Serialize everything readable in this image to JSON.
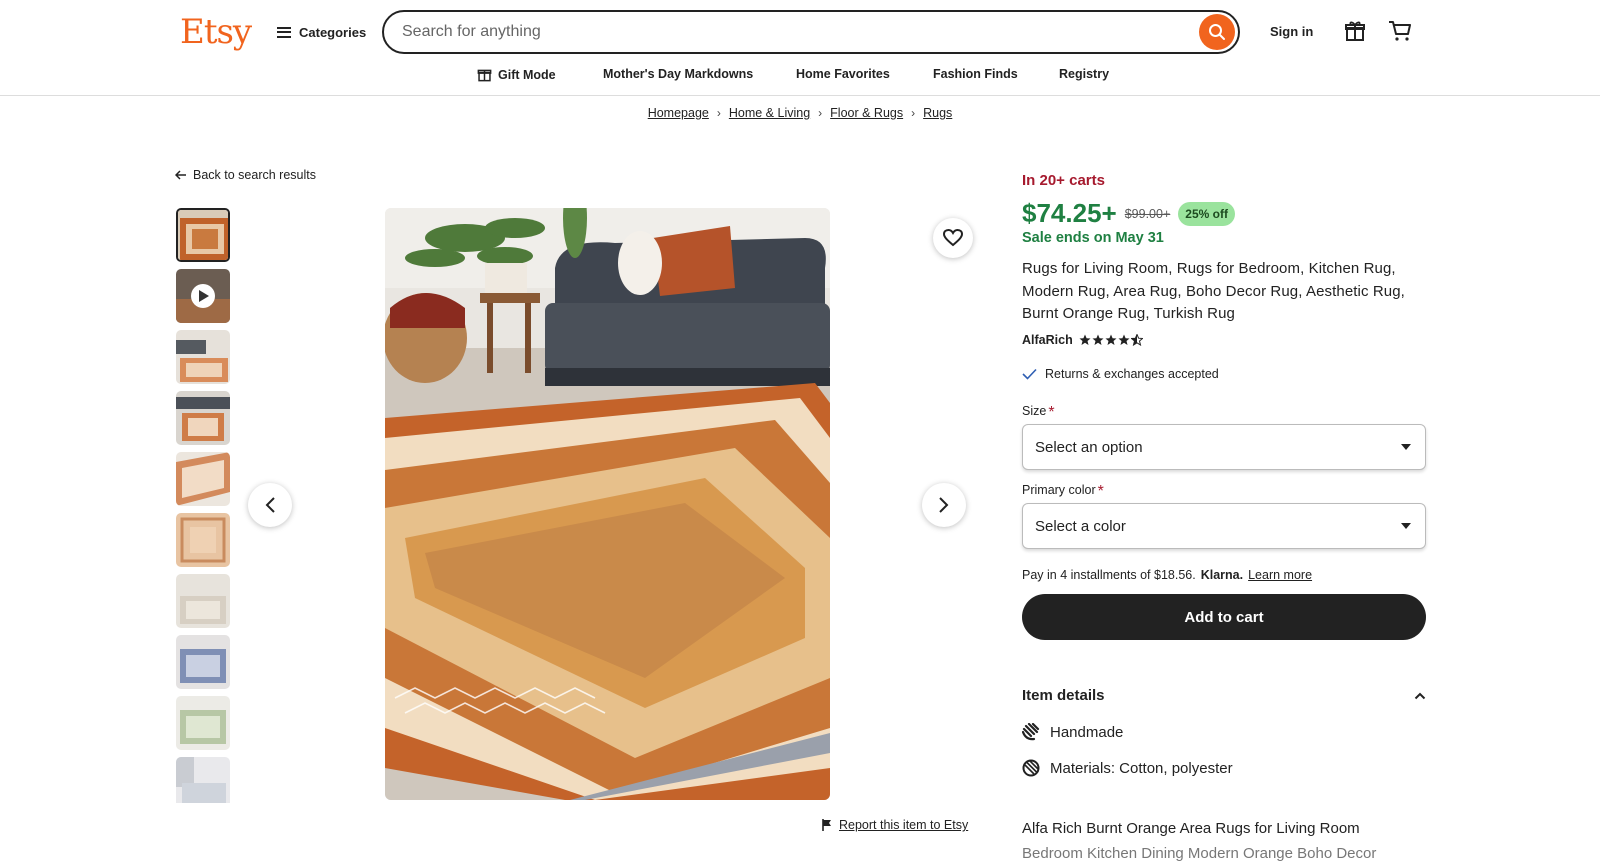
{
  "header": {
    "logo": "Etsy",
    "categories_label": "Categories",
    "search_placeholder": "Search for anything",
    "signin_label": "Sign in"
  },
  "nav": {
    "items": [
      {
        "label": "Gift Mode"
      },
      {
        "label": "Mother's Day Markdowns"
      },
      {
        "label": "Home Favorites"
      },
      {
        "label": "Fashion Finds"
      },
      {
        "label": "Registry"
      }
    ]
  },
  "breadcrumb": [
    "Homepage",
    "Home & Living",
    "Floor & Rugs",
    "Rugs"
  ],
  "back_link": "Back to search results",
  "gallery": {
    "thumb_count": 10,
    "active_index": 0,
    "video_thumb_index": 1
  },
  "report_link": "Report this item to Etsy",
  "product": {
    "in_carts": "In 20+ carts",
    "price": "$74.25+",
    "original_price": "$99.00+",
    "discount": "25% off",
    "sale_ends": "Sale ends on May 31",
    "title": "Rugs for Living Room, Rugs for Bedroom, Kitchen Rug, Modern Rug, Area Rug, Boho Decor Rug, Aesthetic Rug, Burnt Orange Rug, Turkish Rug",
    "shop_name": "AlfaRich",
    "rating": 4.5,
    "returns": "Returns & exchanges accepted",
    "size_label": "Size",
    "size_value": "Select an option",
    "color_label": "Primary color",
    "color_value": "Select a color",
    "klarna_text": "Pay in 4 installments of $18.56.",
    "klarna_brand": "Klarna.",
    "klarna_link": "Learn more",
    "add_to_cart": "Add to cart",
    "item_details_label": "Item details",
    "details": [
      {
        "icon": "hand-icon",
        "text": "Handmade"
      },
      {
        "icon": "materials-icon",
        "text": "Materials: Cotton, polyester"
      }
    ],
    "description_line1": "Alfa Rich Burnt Orange Area Rugs for Living Room",
    "description_line2": "Bedroom Kitchen Dining Modern Orange Boho Decor"
  },
  "colors": {
    "brand": "#F1641E",
    "price_green": "#1F8042",
    "carts_red": "#A61A2E",
    "discount_bg": "#9AE39D"
  }
}
